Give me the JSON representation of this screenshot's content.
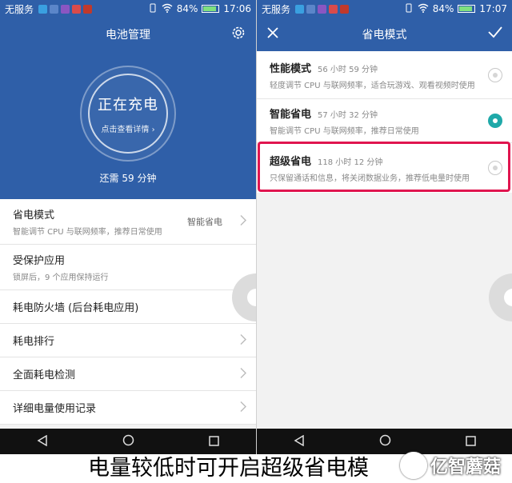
{
  "left": {
    "status": {
      "carrier": "无服务",
      "battery": "84%",
      "time": "17:06",
      "battery_level": 0.84
    },
    "title": "电池管理",
    "ring": {
      "status": "正在充电",
      "details": "点击查看详情"
    },
    "remaining": "还需 59 分钟",
    "items": [
      {
        "title": "省电模式",
        "sub": "智能调节 CPU 与联网频率，推荐日常使用",
        "value": "智能省电"
      },
      {
        "title": "受保护应用",
        "sub": "锁屏后，9 个应用保持运行"
      },
      {
        "title": "耗电防火墙 (后台耗电应用)"
      },
      {
        "title": "耗电排行"
      },
      {
        "title": "全面耗电检测"
      },
      {
        "title": "详细电量使用记录"
      }
    ]
  },
  "right": {
    "status": {
      "carrier": "无服务",
      "battery": "84%",
      "time": "17:07",
      "battery_level": 0.84
    },
    "title": "省电模式",
    "modes": [
      {
        "name": "性能模式",
        "time": "56 小时 59 分钟",
        "desc": "轻度调节 CPU 与联网频率，适合玩游戏、观看视频时使用",
        "selected": false
      },
      {
        "name": "智能省电",
        "time": "57 小时 32 分钟",
        "desc": "智能调节 CPU 与联网频率，推荐日常使用",
        "selected": true
      },
      {
        "name": "超级省电",
        "time": "118 小时 12 分钟",
        "desc": "只保留通话和信息，将关闭数据业务，推荐低电量时使用",
        "selected": false
      }
    ]
  },
  "caption": "电量较低时可开启超级省电模",
  "watermark": "亿智蘑菇",
  "colors": {
    "primary": "#2f5fa8",
    "accent": "#1fa9a9",
    "highlight": "#e0154f"
  }
}
